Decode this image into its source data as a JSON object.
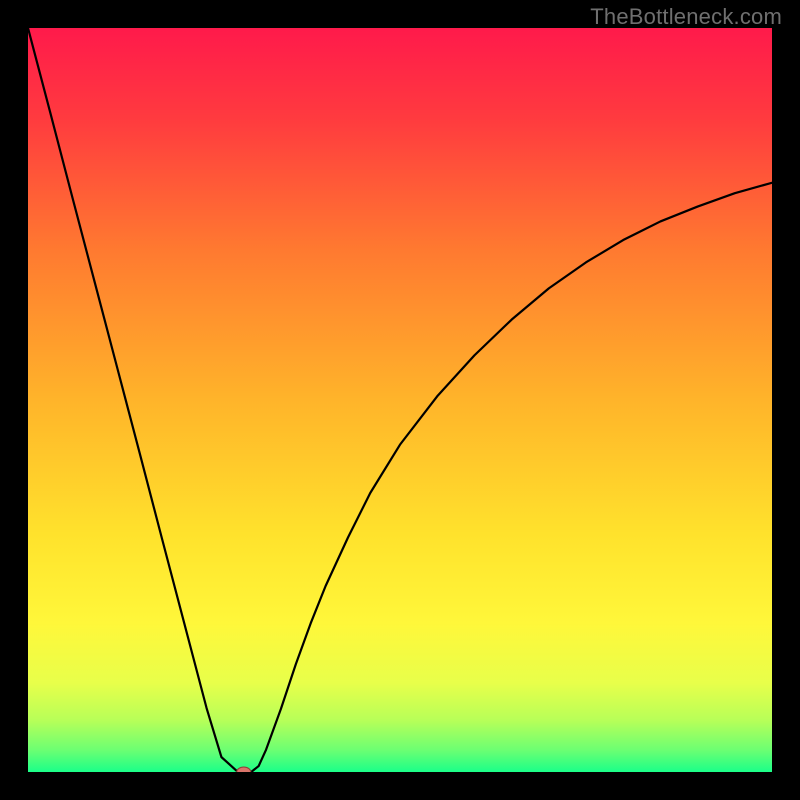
{
  "watermark": "TheBottleneck.com",
  "chart_data": {
    "type": "line",
    "title": "",
    "xlabel": "",
    "ylabel": "",
    "xlim": [
      0,
      100
    ],
    "ylim": [
      0,
      100
    ],
    "grid": false,
    "legend": false,
    "background_gradient": {
      "stops": [
        {
          "offset": 0.0,
          "color": "#ff1a4b"
        },
        {
          "offset": 0.12,
          "color": "#ff3a3f"
        },
        {
          "offset": 0.3,
          "color": "#ff7a30"
        },
        {
          "offset": 0.5,
          "color": "#ffb42a"
        },
        {
          "offset": 0.68,
          "color": "#ffe22c"
        },
        {
          "offset": 0.8,
          "color": "#fff73a"
        },
        {
          "offset": 0.88,
          "color": "#e8ff4a"
        },
        {
          "offset": 0.93,
          "color": "#b8ff58"
        },
        {
          "offset": 0.97,
          "color": "#6dff72"
        },
        {
          "offset": 1.0,
          "color": "#1bff89"
        }
      ]
    },
    "series": [
      {
        "name": "curve",
        "color": "#000000",
        "width": 2.2,
        "x": [
          0,
          3,
          6,
          9,
          12,
          15,
          18,
          21,
          24,
          26,
          28,
          29,
          30,
          31,
          32,
          34,
          36,
          38,
          40,
          43,
          46,
          50,
          55,
          60,
          65,
          70,
          75,
          80,
          85,
          90,
          95,
          100
        ],
        "y": [
          100,
          88.6,
          77.1,
          65.7,
          54.3,
          42.9,
          31.4,
          20.0,
          8.6,
          2.0,
          0.2,
          0.0,
          0.0,
          0.8,
          3.0,
          8.5,
          14.5,
          20.0,
          25.0,
          31.5,
          37.5,
          44.0,
          50.5,
          56.0,
          60.8,
          65.0,
          68.5,
          71.5,
          74.0,
          76.0,
          77.8,
          79.2
        ]
      }
    ],
    "marker": {
      "x": 29,
      "y": 0,
      "color_fill": "#d9746a",
      "color_stroke": "#8f3e36",
      "rx": 7,
      "ry": 5
    }
  }
}
